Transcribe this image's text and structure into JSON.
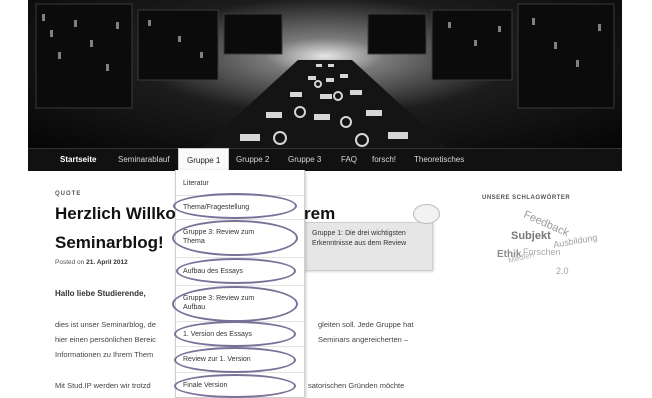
{
  "nav": {
    "items": [
      "Startseite",
      "Seminarablauf",
      "Gruppe 1",
      "Gruppe 2",
      "Gruppe 3",
      "FAQ",
      "forsch!",
      "Theoretisches"
    ],
    "active_index": 2
  },
  "dropdown": {
    "items": [
      {
        "lines": [
          "Literatur"
        ],
        "circled": false
      },
      {
        "lines": [
          "Thema/Fragestellung"
        ],
        "circled": true
      },
      {
        "lines": [
          "Gruppe 3: Review zum",
          "Thema"
        ],
        "circled": true
      },
      {
        "lines": [
          "Aufbau des Essays"
        ],
        "circled": true
      },
      {
        "lines": [
          "Gruppe 3: Review zum",
          "Aufbau"
        ],
        "circled": true
      },
      {
        "lines": [
          "1. Version des Essays"
        ],
        "circled": true
      },
      {
        "lines": [
          "Review zur 1. Version"
        ],
        "circled": true
      },
      {
        "lines": [
          "Finale Version"
        ],
        "circled": true
      }
    ],
    "oval_color": "#7a7198"
  },
  "post": {
    "format_label": "QUOTE",
    "title_line1_start": "Herzlich Willkor",
    "title_line1_end": "rem",
    "title_line2": "Seminarblog!",
    "posted_prefix": "Posted on",
    "posted_date": "21. April 2012",
    "greeting": "Hallo liebe Studierende,",
    "para1_left": [
      "dies ist unser Seminarblog, de",
      "hier einen persönlichen Bereic",
      "Informationen zu Ihrem Them"
    ],
    "para1_right": [
      "gleiten soll. Jede Gruppe hat",
      "Seminars angereicherten –"
    ],
    "para2_left": "Mit Stud.IP werden wir trotzd",
    "para2_right": "satorischen Gründen möchte"
  },
  "callout": {
    "text": "Gruppe 1: Die drei wichtigsten Erkenntnisse aus dem Review"
  },
  "sidebar": {
    "heading": "UNSERE SCHLAGWÖRTER",
    "tags": [
      "Feedback",
      "Subjekt",
      "Ausbildung",
      "Ethik",
      "Forschen",
      "Medien",
      "2.0"
    ]
  },
  "colors": {
    "nav_bg": "#111111",
    "accent_oval": "#7a7198",
    "callout_bg": "#e6e6e6"
  }
}
